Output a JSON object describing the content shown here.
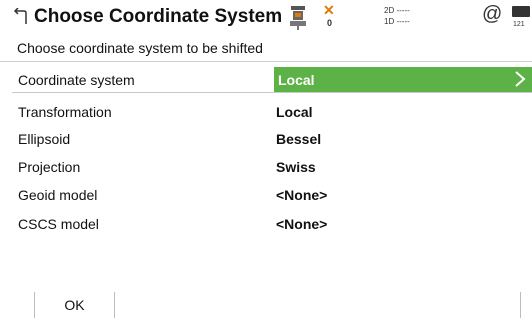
{
  "header": {
    "title": "Choose Coordinate System",
    "icons": {
      "back": "back-icon",
      "sensor": "total-station-icon",
      "satellite_off": "x-icon",
      "connection": "at-icon",
      "battery": "battery-icon"
    },
    "satellite_count": "0",
    "gnss_2d": "2D -----",
    "gnss_1d": "1D -----",
    "battery_text": "121"
  },
  "subtitle": "Choose coordinate system to be shifted",
  "coordinate_system": {
    "label": "Coordinate system",
    "value": "Local"
  },
  "details": [
    {
      "label": "Transformation",
      "value": "Local"
    },
    {
      "label": "Ellipsoid",
      "value": "Bessel"
    },
    {
      "label": "Projection",
      "value": "Swiss"
    },
    {
      "label": "Geoid model",
      "value": "<None>"
    },
    {
      "label": "CSCS model",
      "value": "<None>"
    }
  ],
  "footer": {
    "ok_label": "OK"
  },
  "colors": {
    "accent_green": "#5cb247",
    "warning_orange": "#e07a00"
  }
}
